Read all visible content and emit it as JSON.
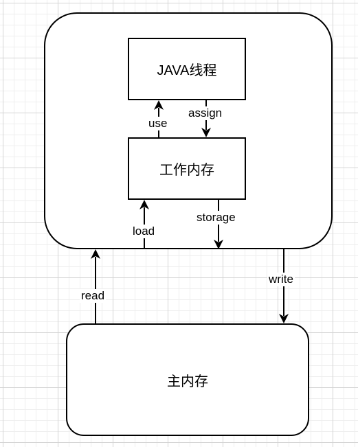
{
  "nodes": {
    "java_thread": "JAVA线程",
    "working_memory": "工作内存",
    "main_memory": "主内存"
  },
  "edges": {
    "use": "use",
    "assign": "assign",
    "load": "load",
    "storage": "storage",
    "read": "read",
    "write": "write"
  }
}
